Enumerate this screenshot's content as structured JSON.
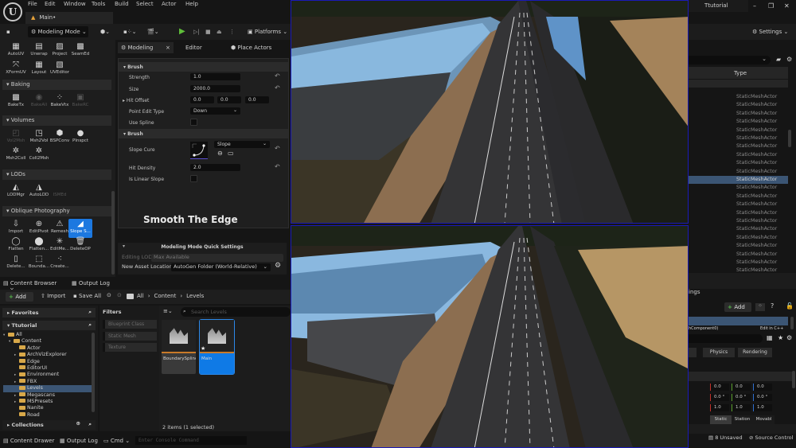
{
  "app": {
    "logo": "U",
    "menu": [
      "File",
      "Edit",
      "Window",
      "Tools",
      "Build",
      "Select",
      "Actor",
      "Help"
    ],
    "document_tab": "Main•",
    "project_tab": "Ttutorial",
    "window_controls": {
      "minimize": "–",
      "restore": "❐",
      "close": "✕"
    }
  },
  "toolbar": {
    "save_icon": "💾",
    "mode": "Modeling Mode",
    "platforms": "Platforms",
    "settings": "Settings"
  },
  "palette": {
    "uv_tools": [
      {
        "label": "AutoUV",
        "icon": "▦",
        "disabled": false
      },
      {
        "label": "Unwrap",
        "icon": "▤",
        "disabled": false
      },
      {
        "label": "Project",
        "icon": "▨",
        "disabled": false
      },
      {
        "label": "SeamEd",
        "icon": "▩",
        "disabled": false
      },
      {
        "label": "XFormUV",
        "icon": "⤧",
        "disabled": false
      },
      {
        "label": "Layout",
        "icon": "▦",
        "disabled": false
      },
      {
        "label": "UVEditor",
        "icon": "▧",
        "disabled": false
      }
    ],
    "sections": [
      {
        "title": "Baking",
        "tools": [
          {
            "label": "BakeTx",
            "icon": "▩",
            "disabled": false
          },
          {
            "label": "BakeAll",
            "icon": "◉",
            "disabled": true
          },
          {
            "label": "BakeVtx",
            "icon": "⁘",
            "disabled": false
          },
          {
            "label": "BakeRC",
            "icon": "▣",
            "disabled": true
          }
        ]
      },
      {
        "title": "Volumes",
        "tools": [
          {
            "label": "Vol2Msh",
            "icon": "◰",
            "disabled": true
          },
          {
            "label": "Msh2Vol",
            "icon": "◳",
            "disabled": false
          },
          {
            "label": "BSPConv",
            "icon": "⬢",
            "disabled": false
          },
          {
            "label": "PInspct",
            "icon": "●",
            "disabled": false
          },
          {
            "label": "Msh2Coll",
            "icon": "✲",
            "disabled": false
          },
          {
            "label": "Coll2Msh",
            "icon": "✲",
            "disabled": false
          }
        ]
      },
      {
        "title": "LODs",
        "tools": [
          {
            "label": "LODMgr",
            "icon": "◭",
            "disabled": false
          },
          {
            "label": "AutoLOD",
            "icon": "◮",
            "disabled": false
          },
          {
            "label": "ISMEd",
            "icon": "",
            "disabled": true
          }
        ]
      },
      {
        "title": "Oblique Photography",
        "tools": [
          {
            "label": "Import",
            "icon": "⇩",
            "disabled": false,
            "active": false
          },
          {
            "label": "EditPivot",
            "icon": "⊕",
            "disabled": false,
            "active": false
          },
          {
            "label": "Remesh",
            "icon": "⚠",
            "disabled": false,
            "active": false
          },
          {
            "label": "Slope S...",
            "icon": "◢",
            "disabled": false,
            "active": true
          },
          {
            "label": "Flatten",
            "icon": "◯",
            "disabled": false,
            "active": false
          },
          {
            "label": "Flatten...",
            "icon": "⬤",
            "disabled": false,
            "active": false
          },
          {
            "label": "EditMe...",
            "icon": "✳",
            "disabled": false,
            "active": false
          },
          {
            "label": "DeleteOP",
            "icon": "🗑",
            "disabled": false,
            "active": false
          },
          {
            "label": "Delete...",
            "icon": "▯",
            "disabled": false,
            "active": false
          },
          {
            "label": "Bounda...",
            "icon": "⬚",
            "disabled": false,
            "active": false
          },
          {
            "label": "Create...",
            "icon": "⁖",
            "disabled": false,
            "active": false
          }
        ]
      }
    ]
  },
  "modeling_panel": {
    "tabs": [
      {
        "label": "Modeling",
        "active": true,
        "closable": true
      },
      {
        "label": "Editor",
        "active": false
      },
      {
        "label": "Place Actors",
        "active": false
      }
    ],
    "categories": [
      {
        "title": "Brush"
      },
      {
        "title": "Brush"
      }
    ],
    "properties": {
      "strength": {
        "label": "Strength",
        "value": "1.0"
      },
      "size": {
        "label": "Size",
        "value": "2000.0"
      },
      "hit_offset": {
        "label": "Hit Offset",
        "values": [
          "0.0",
          "0.0",
          "0.0"
        ]
      },
      "point_edit_type": {
        "label": "Point Edit Type",
        "value": "Down"
      },
      "use_spline": {
        "label": "Use Spline",
        "checked": false
      },
      "slope_cure": {
        "label": "Slope Cure",
        "value": "Slope"
      },
      "hit_density": {
        "label": "Hit Density",
        "value": "2.0"
      },
      "is_linear_slope": {
        "label": "Is Linear Slope",
        "checked": false
      }
    },
    "caption": "Smooth The Edge",
    "quick_settings": {
      "title": "Modeling Mode Quick Settings",
      "editing_lod_label": "Editing LOD",
      "editing_lod_value": "Max Available",
      "asset_location_label": "New Asset Location",
      "asset_location_value": "AutoGen Folder (World-Relative)"
    }
  },
  "content_browser": {
    "tabs": [
      "Content Browser",
      "Output Log"
    ],
    "add": "Add",
    "import": "Import",
    "save_all": "Save All",
    "breadcrumb": [
      "All",
      "Content",
      "Levels"
    ],
    "favorites": "Favorites",
    "project": "Ttutorial",
    "tree": [
      {
        "label": "All",
        "depth": 0,
        "expanded": true,
        "open": true
      },
      {
        "label": "Content",
        "depth": 1,
        "expanded": true,
        "open": true
      },
      {
        "label": "Actor",
        "depth": 2
      },
      {
        "label": "ArchVizExplorer",
        "depth": 2,
        "has_children": true
      },
      {
        "label": "Edge",
        "depth": 2
      },
      {
        "label": "EditorUI",
        "depth": 2
      },
      {
        "label": "Environment",
        "depth": 2,
        "has_children": true
      },
      {
        "label": "FBX",
        "depth": 2,
        "has_children": true
      },
      {
        "label": "Levels",
        "depth": 2,
        "selected": true
      },
      {
        "label": "Megascans",
        "depth": 2,
        "has_children": true
      },
      {
        "label": "MSPresets",
        "depth": 2,
        "has_children": true
      },
      {
        "label": "Nanite",
        "depth": 2
      },
      {
        "label": "Road",
        "depth": 2
      }
    ],
    "collections": "Collections",
    "filters_title": "Filters",
    "filters": [
      "Blueprint Class",
      "Static Mesh",
      "Texture"
    ],
    "search_placeholder": "Search Levels",
    "assets": [
      {
        "name": "BoundarySpline",
        "selected": false
      },
      {
        "name": "Main",
        "selected": true
      }
    ],
    "item_count": "2 items (1 selected)"
  },
  "status_bar": {
    "content_drawer": "Content Drawer",
    "output_log": "Output Log",
    "cmd": "Cmd",
    "console_placeholder": "Enter Console Command",
    "unsaved": "8 Unsaved",
    "source_control": "Source Control"
  },
  "outliner": {
    "column_type": "Type",
    "rows": [
      "StaticMeshActor",
      "StaticMeshActor",
      "StaticMeshActor",
      "StaticMeshActor",
      "StaticMeshActor",
      "StaticMeshActor",
      "StaticMeshActor",
      "StaticMeshActor",
      "StaticMeshActor",
      "StaticMeshActor",
      "StaticMeshActor",
      "StaticMeshActor",
      "StaticMeshActor",
      "StaticMeshActor",
      "StaticMeshActor",
      "StaticMeshActor",
      "StaticMeshActor",
      "StaticMeshActor",
      "StaticMeshActor",
      "StaticMeshActor",
      "StaticMeshActor",
      "StaticMeshActor"
    ],
    "selected_index": 10
  },
  "details": {
    "title_fragment": "ings",
    "add": "Add",
    "component_fragment": "hComponent0)",
    "component_edit_fragment": "Edit in C++",
    "tabs": [
      "Physics",
      "Rendering"
    ],
    "location": [
      "0.0",
      "0.0",
      "0.0"
    ],
    "rotation": [
      "0.0 °",
      "0.0 °",
      "0.0 °"
    ],
    "scale": [
      "1.0",
      "1.0",
      "1.0"
    ],
    "mobility": [
      "Static",
      "Station",
      "Movabl"
    ],
    "axis_colors": {
      "x": "#c0312b",
      "y": "#5aa02c",
      "z": "#2f6fd0"
    }
  },
  "theme": {
    "accent": "#0f7ae6",
    "selection": "#3b5574",
    "play_green": "#5fbf3a",
    "folder": "#d8a849",
    "viewport_border": "#1a1ab8"
  }
}
